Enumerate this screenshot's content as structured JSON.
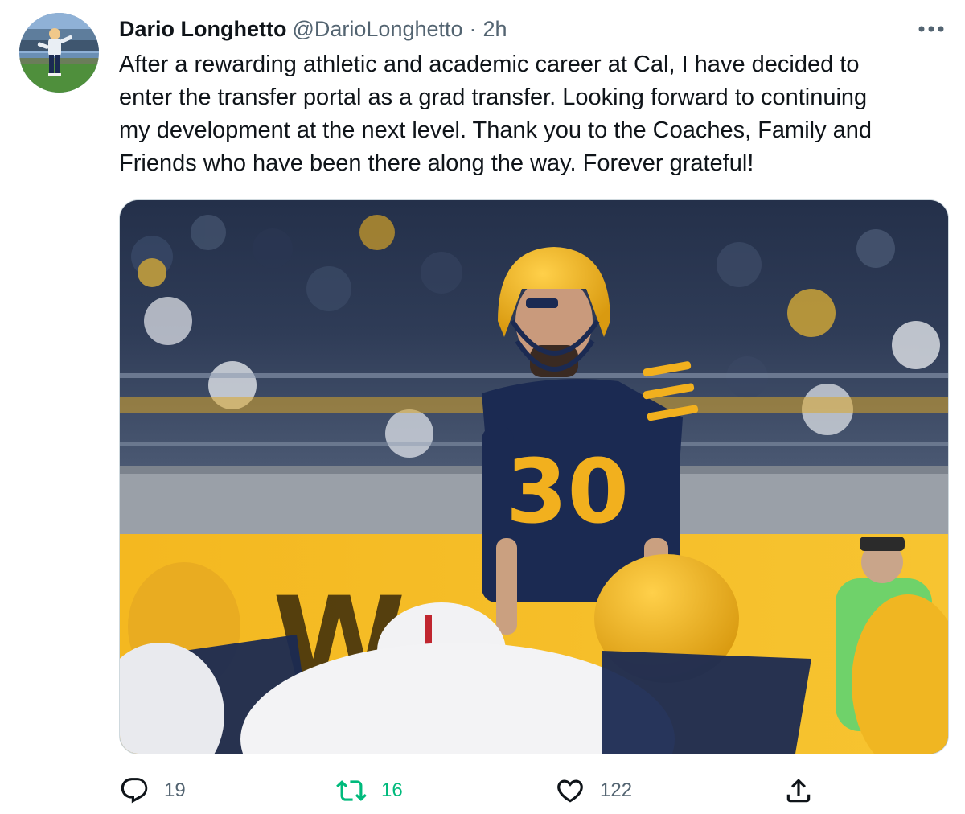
{
  "tweet": {
    "author_name": "Dario Longhetto",
    "author_handle": "@DarioLonghetto",
    "separator": "·",
    "time": "2h",
    "text": "After a rewarding athletic and academic career at Cal, I have decided to\nenter the transfer portal as a grad transfer. Looking forward to continuing\nmy development at the next level. Thank you to the Coaches, Family and\nFriends who have been there along the way. Forever grateful!",
    "more_icon": "more-horizontal-icon"
  },
  "media": {
    "jersey_number": "30",
    "banner_letter": "W"
  },
  "actions": {
    "reply_count": "19",
    "retweet_count": "16",
    "like_count": "122",
    "reply_icon": "comment-icon",
    "retweet_icon": "retweet-icon",
    "like_icon": "heart-icon",
    "share_icon": "share-icon"
  },
  "colors": {
    "retweet_active": "#00ba7c",
    "secondary_text": "#536471",
    "primary_text": "#0f1419",
    "cal_gold": "#f2b01e",
    "cal_navy": "#1b2a52"
  }
}
